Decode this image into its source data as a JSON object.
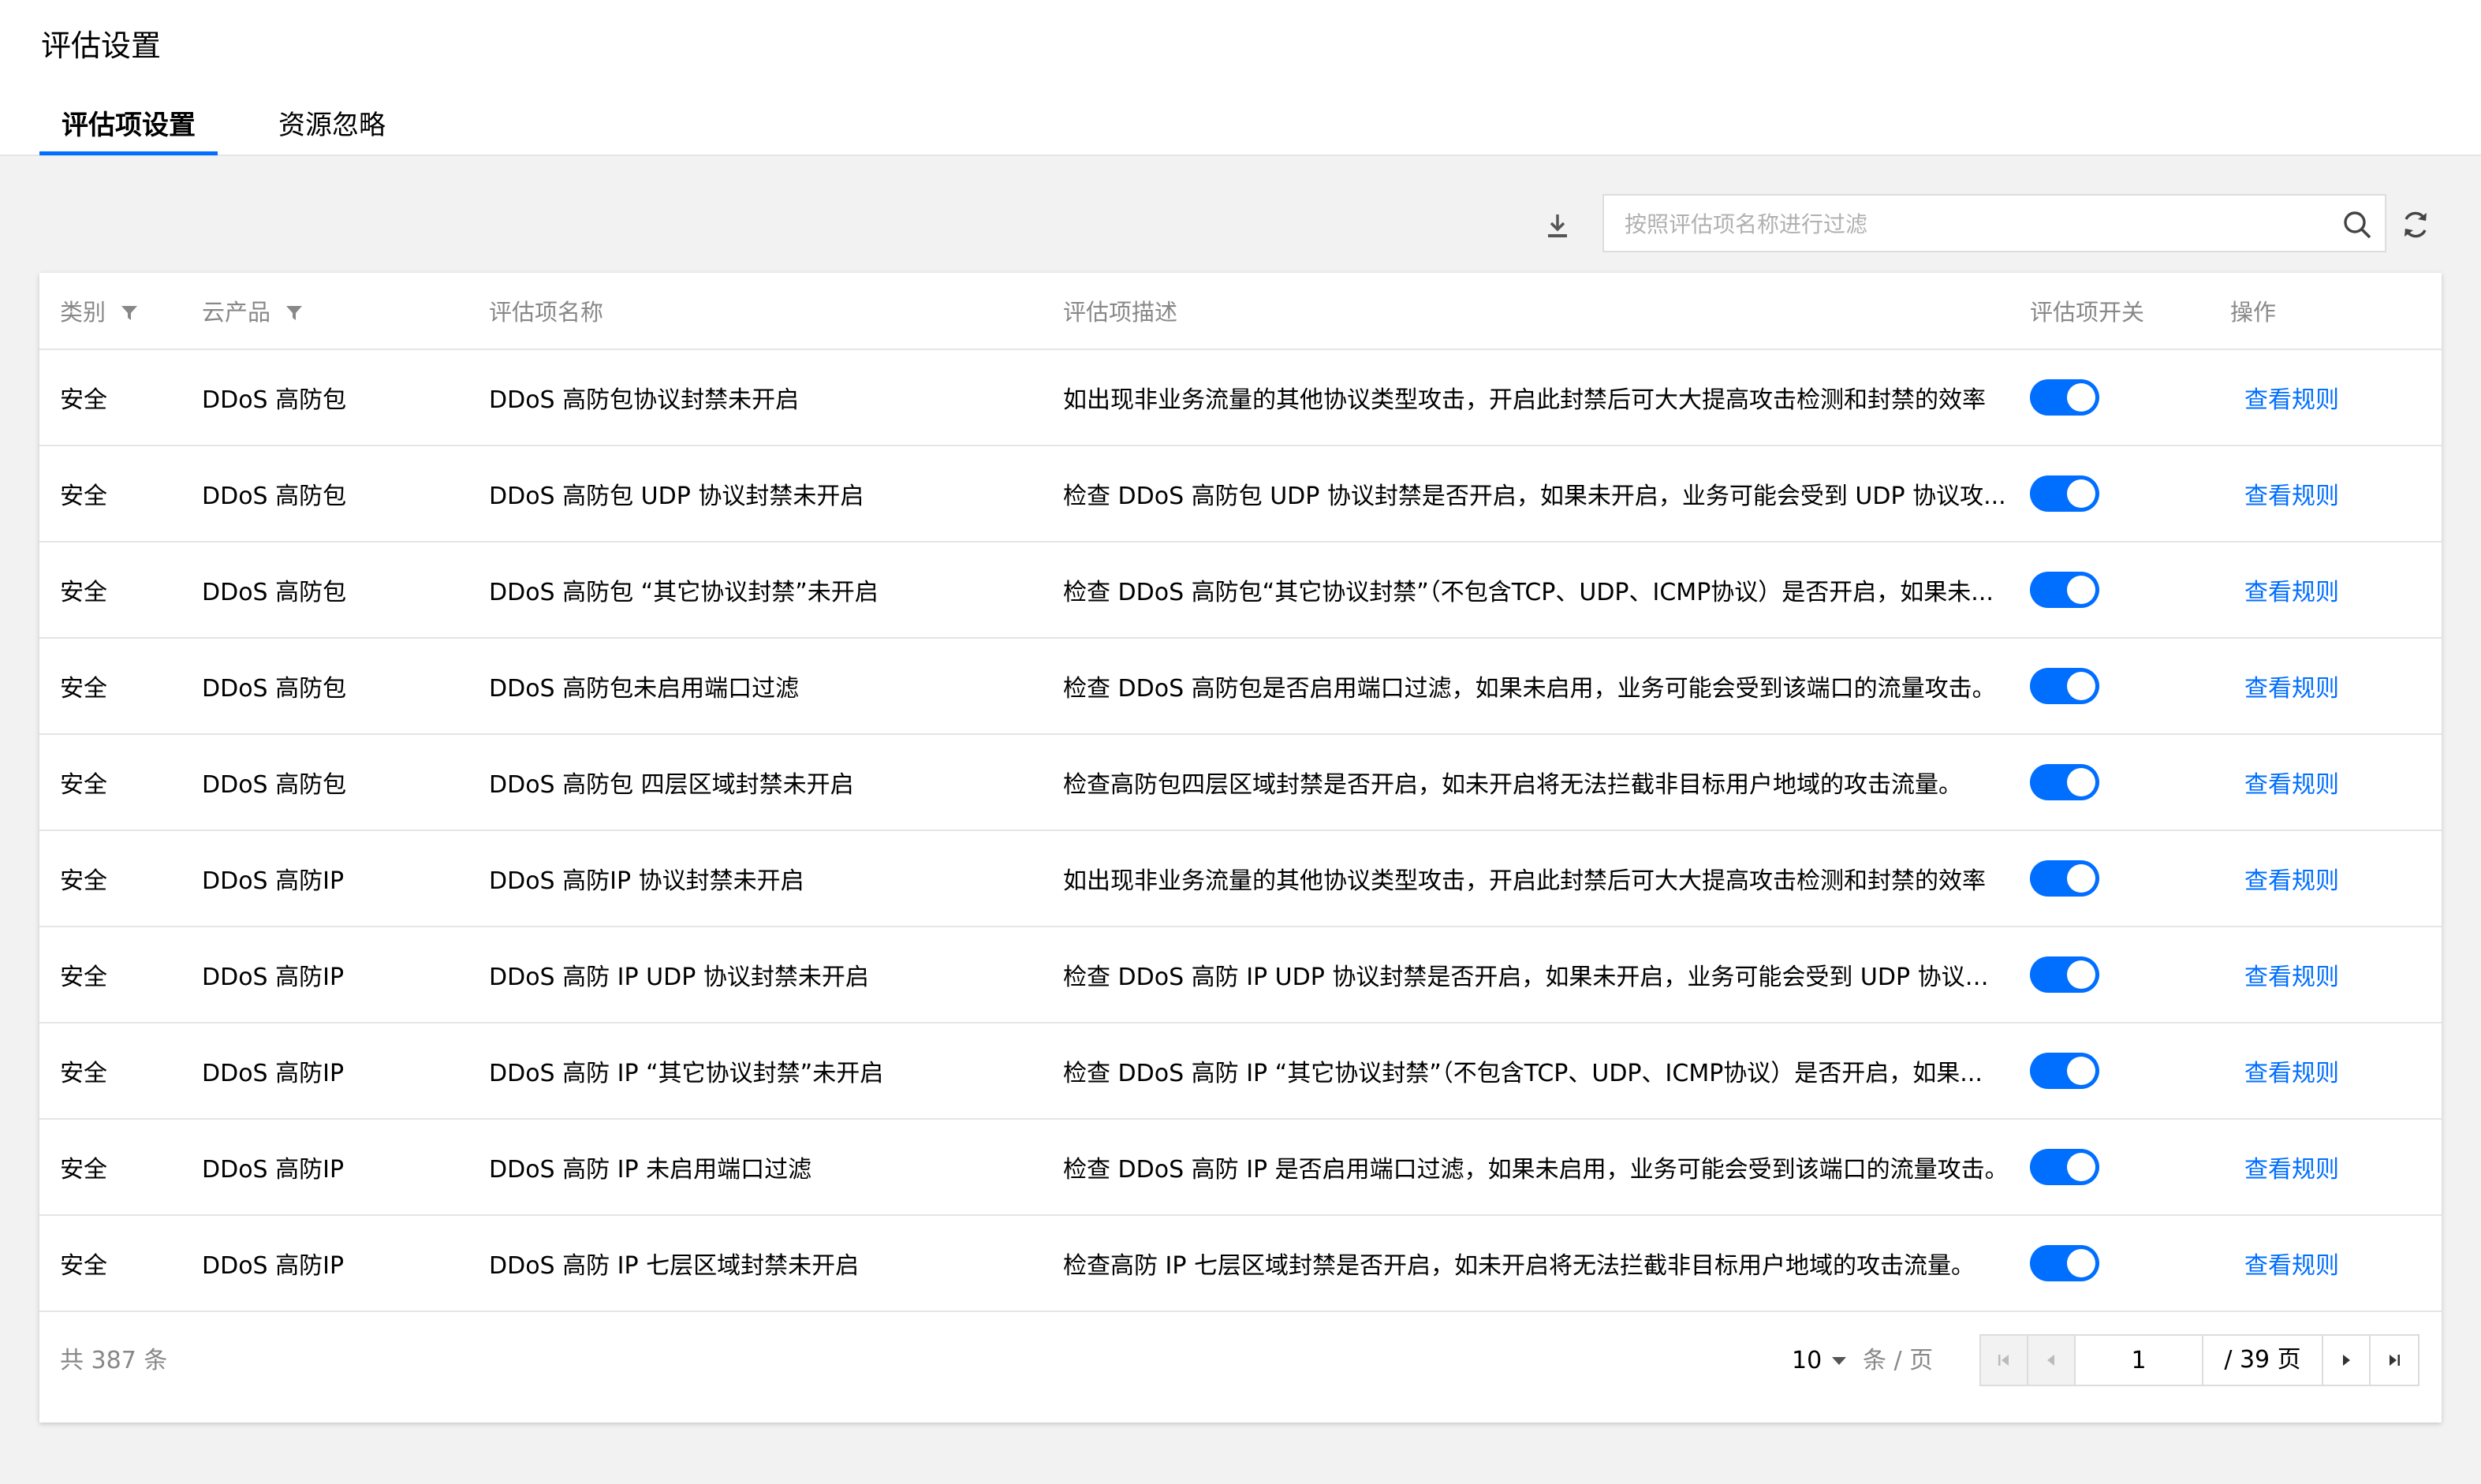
{
  "page": {
    "title": "评估设置"
  },
  "tabs": [
    {
      "label": "评估项设置",
      "active": true
    },
    {
      "label": "资源忽略",
      "active": false
    }
  ],
  "toolbar": {
    "search_placeholder": "按照评估项名称进行过滤",
    "download_icon": "download-icon",
    "search_icon": "search-icon",
    "refresh_icon": "refresh-icon"
  },
  "table": {
    "columns": {
      "category": "类别",
      "product": "云产品",
      "name": "评估项名称",
      "description": "评估项描述",
      "switch": "评估项开关",
      "action": "操作"
    },
    "rows": [
      {
        "category": "安全",
        "product": "DDoS 高防包",
        "name": "DDoS 高防包协议封禁未开启",
        "description": "如出现非业务流量的其他协议类型攻击，开启此封禁后可大大提高攻击检测和封禁的效率",
        "enabled": true,
        "action": "查看规则"
      },
      {
        "category": "安全",
        "product": "DDoS 高防包",
        "name": "DDoS 高防包 UDP 协议封禁未开启",
        "description": "检查 DDoS 高防包 UDP 协议封禁是否开启，如果未开启，业务可能会受到 UDP 协议攻...",
        "enabled": true,
        "action": "查看规则"
      },
      {
        "category": "安全",
        "product": "DDoS 高防包",
        "name": "DDoS 高防包 “其它协议封禁”未开启",
        "description": "检查 DDoS 高防包“其它协议封禁”（不包含TCP、UDP、ICMP协议）是否开启，如果未...",
        "enabled": true,
        "action": "查看规则"
      },
      {
        "category": "安全",
        "product": "DDoS 高防包",
        "name": "DDoS 高防包未启用端口过滤",
        "description": "检查 DDoS 高防包是否启用端口过滤，如果未启用，业务可能会受到该端口的流量攻击。",
        "enabled": true,
        "action": "查看规则"
      },
      {
        "category": "安全",
        "product": "DDoS 高防包",
        "name": "DDoS 高防包 四层区域封禁未开启",
        "description": "检查高防包四层区域封禁是否开启，如未开启将无法拦截非目标用户地域的攻击流量。",
        "enabled": true,
        "action": "查看规则"
      },
      {
        "category": "安全",
        "product": "DDoS 高防IP",
        "name": "DDoS 高防IP 协议封禁未开启",
        "description": "如出现非业务流量的其他协议类型攻击，开启此封禁后可大大提高攻击检测和封禁的效率",
        "enabled": true,
        "action": "查看规则"
      },
      {
        "category": "安全",
        "product": "DDoS 高防IP",
        "name": "DDoS 高防 IP UDP 协议封禁未开启",
        "description": "检查 DDoS 高防 IP UDP 协议封禁是否开启，如果未开启，业务可能会受到 UDP 协议攻...",
        "enabled": true,
        "action": "查看规则"
      },
      {
        "category": "安全",
        "product": "DDoS 高防IP",
        "name": "DDoS 高防 IP “其它协议封禁”未开启",
        "description": "检查 DDoS 高防 IP “其它协议封禁”（不包含TCP、UDP、ICMP协议）是否开启，如果...",
        "enabled": true,
        "action": "查看规则"
      },
      {
        "category": "安全",
        "product": "DDoS 高防IP",
        "name": "DDoS 高防 IP 未启用端口过滤",
        "description": "检查 DDoS 高防 IP 是否启用端口过滤，如果未启用，业务可能会受到该端口的流量攻击。",
        "enabled": true,
        "action": "查看规则"
      },
      {
        "category": "安全",
        "product": "DDoS 高防IP",
        "name": "DDoS 高防 IP 七层区域封禁未开启",
        "description": "检查高防 IP 七层区域封禁是否开启，如未开启将无法拦截非目标用户地域的攻击流量。",
        "enabled": true,
        "action": "查看规则"
      }
    ]
  },
  "pagination": {
    "total_text": "共 387 条",
    "page_size": "10",
    "page_size_unit": "条 / 页",
    "current_page": "1",
    "total_pages_text": "/ 39 页"
  },
  "colors": {
    "accent": "#006eff",
    "muted_text": "#888888",
    "border": "#e5e5e5"
  }
}
